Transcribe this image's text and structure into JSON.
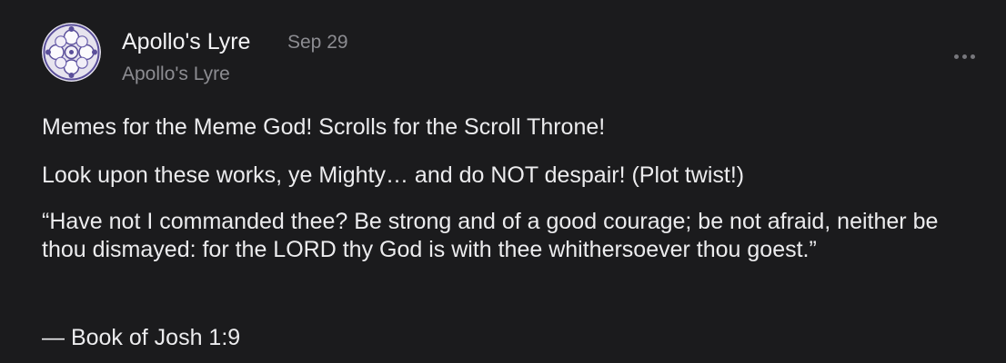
{
  "post": {
    "author": "Apollo's Lyre",
    "date": "Sep 29",
    "publication": "Apollo's Lyre",
    "more_icon": "more-horizontal-icon",
    "avatar_icon": "circle-pattern-avatar",
    "paragraphs": [
      "Memes for the Meme God! Scrolls for the Scroll Throne!",
      "Look upon these works, ye Mighty… and do NOT despair! (Plot twist!)",
      "“Have not I commanded thee? Be strong and of a good courage; be not afraid, neither be thou dismayed: for the LORD thy God is with thee whithersoever thou goest.”",
      "— Book of Josh 1:9"
    ]
  },
  "colors": {
    "background": "#1b1b1d",
    "text_primary": "#ececee",
    "text_secondary": "#8c8c91",
    "avatar_pattern": "#5a4f9a"
  }
}
